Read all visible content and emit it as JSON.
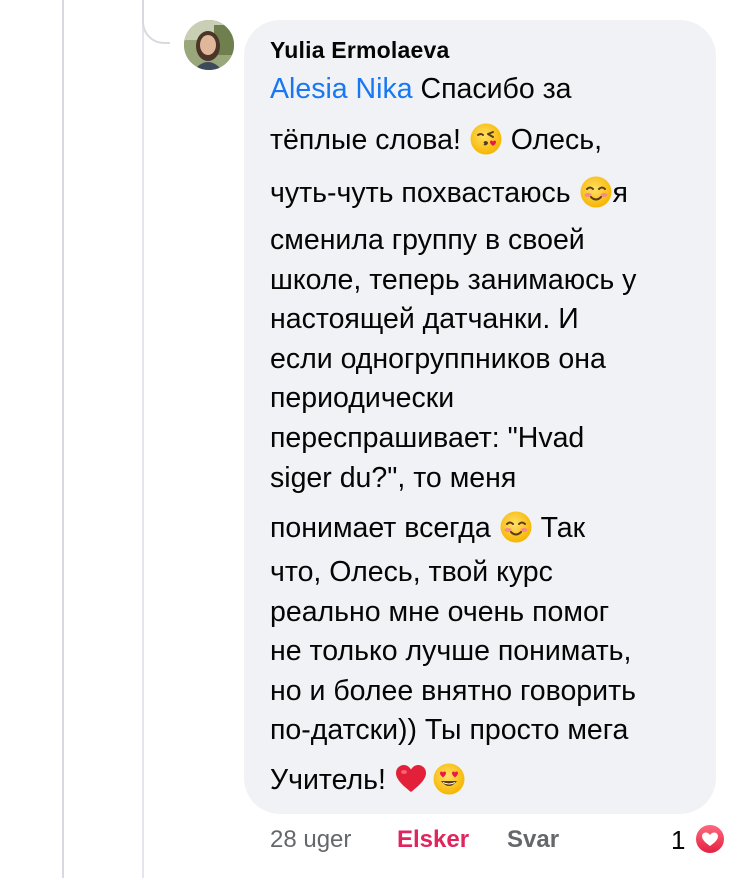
{
  "comment": {
    "author": "Yulia Ermolaeva",
    "lines": [
      {
        "mention": "Alesia Nika",
        "text": " Спасибо за"
      },
      {
        "text_before": "тёплые слова! ",
        "emoji": "kissing-heart-emoji",
        "text_after": " Олесь,"
      },
      {
        "text_before": "чуть-чуть похвастаюсь ",
        "emoji": "smiling-blush-emoji",
        "text_after": "я"
      },
      {
        "text": "сменила группу в своей"
      },
      {
        "text": "школе, теперь занимаюсь у"
      },
      {
        "text": "настоящей датчанки. И"
      },
      {
        "text": "если одногруппников она"
      },
      {
        "text": "периодически"
      },
      {
        "text": "переспрашивает: \"Hvad"
      },
      {
        "text": "siger du?\", то меня"
      },
      {
        "text_before": "понимает всегда ",
        "emoji": "smiling-blush-emoji",
        "text_after": " Так"
      },
      {
        "text": "что, Олесь, твой курс"
      },
      {
        "text": "реально мне очень помог"
      },
      {
        "text": "не только лучше понимать,"
      },
      {
        "text": "но и более внятно говорить"
      },
      {
        "text": "по-датски)) Ты просто мега"
      },
      {
        "text_before": "Учитель! ",
        "emoji": "red-heart-emoji",
        "emoji2": "heart-eyes-emoji"
      }
    ]
  },
  "footer": {
    "time": "28 uger",
    "like_label": "Elsker",
    "reply_label": "Svar",
    "reaction_count": "1",
    "reaction_icon": "love-reaction-icon"
  },
  "colors": {
    "bubble": "#f0f2f5",
    "mention": "#1877f2",
    "like_active": "#e0245e",
    "secondary_text": "#65676b",
    "love_reaction": "#f33e58"
  }
}
